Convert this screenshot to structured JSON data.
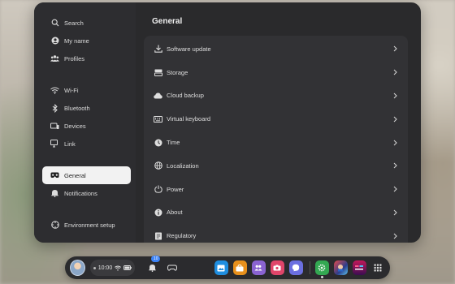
{
  "sidebar": {
    "items": [
      {
        "label": "Search",
        "icon": "search-icon"
      },
      {
        "label": "My name",
        "icon": "account-icon"
      },
      {
        "label": "Profiles",
        "icon": "profiles-icon"
      },
      {
        "label": "Wi-Fi",
        "icon": "wifi-icon"
      },
      {
        "label": "Bluetooth",
        "icon": "bluetooth-icon"
      },
      {
        "label": "Devices",
        "icon": "devices-icon"
      },
      {
        "label": "Link",
        "icon": "link-icon"
      },
      {
        "label": "General",
        "icon": "headset-icon",
        "active": true
      },
      {
        "label": "Notifications",
        "icon": "bell-icon"
      },
      {
        "label": "Environment setup",
        "icon": "environment-icon"
      }
    ]
  },
  "main": {
    "title": "General",
    "rows": [
      {
        "label": "Software update",
        "icon": "download-icon"
      },
      {
        "label": "Storage",
        "icon": "storage-icon"
      },
      {
        "label": "Cloud backup",
        "icon": "cloud-icon"
      },
      {
        "label": "Virtual keyboard",
        "icon": "keyboard-icon"
      },
      {
        "label": "Time",
        "icon": "clock-icon"
      },
      {
        "label": "Localization",
        "icon": "globe-icon"
      },
      {
        "label": "Power",
        "icon": "power-icon"
      },
      {
        "label": "About",
        "icon": "info-icon"
      },
      {
        "label": "Regulatory",
        "icon": "regulatory-icon"
      }
    ]
  },
  "taskbar": {
    "time": "10:00",
    "notification_count": "10",
    "apps": [
      {
        "name": "gallery-app-icon",
        "color": "#1f8ee0"
      },
      {
        "name": "store-app-icon",
        "color": "#e8901c"
      },
      {
        "name": "people-app-icon",
        "color": "#8a63d2"
      },
      {
        "name": "camera-app-icon",
        "color": "#e0456a"
      },
      {
        "name": "messenger-app-icon",
        "color": "#6b6fe0"
      },
      {
        "name": "settings-app-icon",
        "color": "#33a852"
      },
      {
        "name": "game-app-icon",
        "color": "#2c3e8c"
      },
      {
        "name": "beat-saber-app-icon",
        "color": "#c2185b"
      }
    ],
    "colors": {
      "accent": "#3b82f6",
      "panel": "#2a2a2c",
      "active_item": "#f2f2f2"
    }
  }
}
